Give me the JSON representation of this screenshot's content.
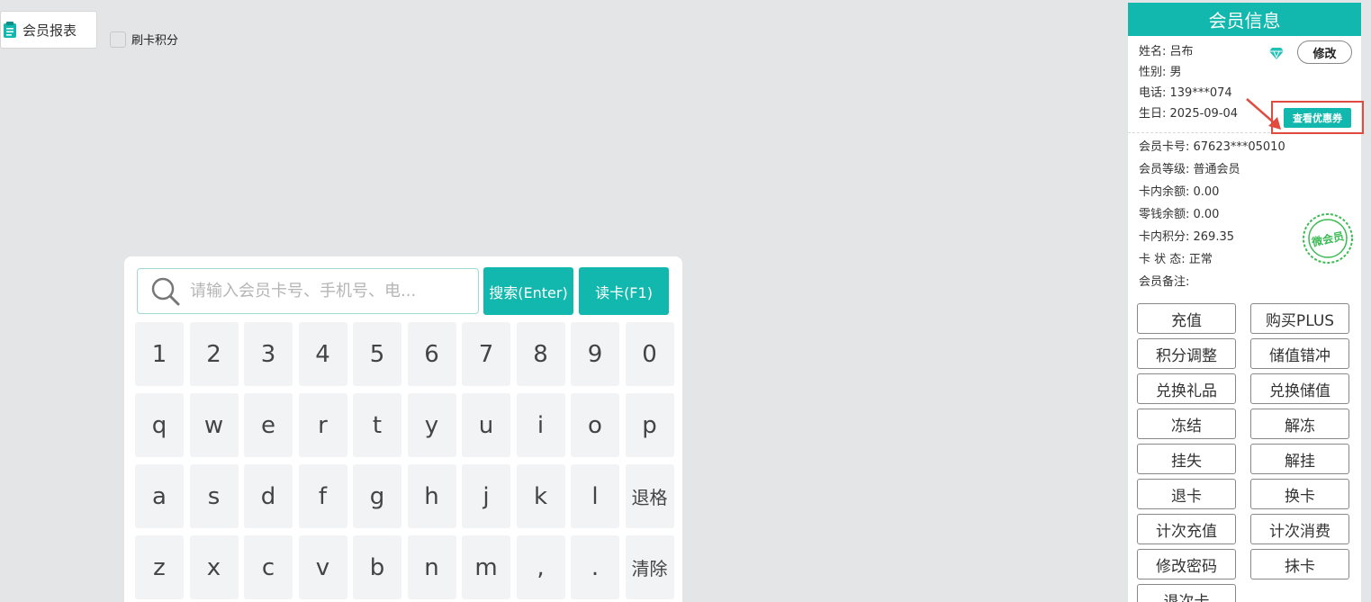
{
  "topbar": {
    "report_tab": "会员报表",
    "swipe_points_label": "刷卡积分"
  },
  "search": {
    "placeholder": "请输入会员卡号、手机号、电...",
    "search_button": "搜索(Enter)",
    "read_card_button": "读卡(F1)"
  },
  "keypad": {
    "rows": [
      [
        "1",
        "2",
        "3",
        "4",
        "5",
        "6",
        "7",
        "8",
        "9",
        "0"
      ],
      [
        "q",
        "w",
        "e",
        "r",
        "t",
        "y",
        "u",
        "i",
        "o",
        "p"
      ],
      [
        "a",
        "s",
        "d",
        "f",
        "g",
        "h",
        "j",
        "k",
        "l",
        "退格"
      ],
      [
        "z",
        "x",
        "c",
        "v",
        "b",
        "n",
        "m",
        ",",
        ".",
        "清除"
      ]
    ]
  },
  "member": {
    "title": "会员信息",
    "name": "姓名: 吕布",
    "gender": "性别: 男",
    "phone": "电话: 139***074",
    "birthday": "生日: 2025-09-04",
    "modify_button": "修改",
    "coupon_button": "查看优惠券",
    "card_no": "会员卡号: 67623***05010",
    "level": "会员等级: 普通会员",
    "balance": "卡内余额: 0.00",
    "change_balance": "零钱余额: 0.00",
    "points": "卡内积分: 269.35",
    "status": "卡 状 态: 正常",
    "remark": "会员备注:",
    "stamp_text": "微会员",
    "accent_color": "#12b8ad",
    "highlight_color": "#e04a3f",
    "actions": [
      "充值",
      "购买PLUS",
      "积分调整",
      "储值错冲",
      "兑换礼品",
      "兑换储值",
      "冻结",
      "解冻",
      "挂失",
      "解挂",
      "退卡",
      "换卡",
      "计次充值",
      "计次消费",
      "修改密码",
      "抹卡",
      "退次卡"
    ]
  }
}
